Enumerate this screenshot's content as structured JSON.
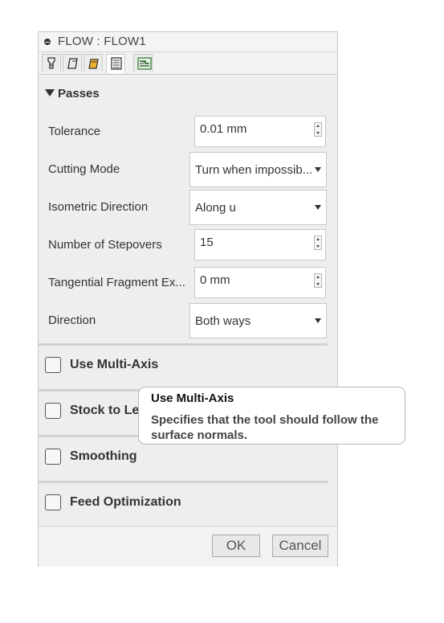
{
  "window": {
    "title": "FLOW : FLOW1"
  },
  "tabs": [
    {
      "icon": "tool-icon",
      "active": false
    },
    {
      "icon": "geometry-icon",
      "active": false
    },
    {
      "icon": "heights-icon",
      "active": false
    },
    {
      "icon": "passes-icon",
      "active": true
    },
    {
      "icon": "linking-icon",
      "active": false
    }
  ],
  "passes": {
    "heading": "Passes",
    "tolerance": {
      "label": "Tolerance",
      "value": "0.01 mm"
    },
    "cutting_mode": {
      "label": "Cutting Mode",
      "value": "Turn when impossib..."
    },
    "isometric_direction": {
      "label": "Isometric Direction",
      "value": "Along u"
    },
    "stepovers": {
      "label": "Number of Stepovers",
      "value": "15"
    },
    "tangential": {
      "label": "Tangential Fragment Ex...",
      "value": "0 mm"
    },
    "direction": {
      "label": "Direction",
      "value": "Both ways"
    }
  },
  "options": {
    "multi_axis": {
      "label": "Use Multi-Axis",
      "checked": false
    },
    "stock_to_leave": {
      "label": "Stock to Le",
      "checked": false
    },
    "smoothing": {
      "label": "Smoothing",
      "checked": false
    },
    "feed_optimization": {
      "label": "Feed Optimization",
      "checked": false
    }
  },
  "buttons": {
    "ok": "OK",
    "cancel": "Cancel"
  },
  "tooltip": {
    "title": "Use Multi-Axis",
    "body": "Specifies that the tool should follow the surface normals."
  }
}
